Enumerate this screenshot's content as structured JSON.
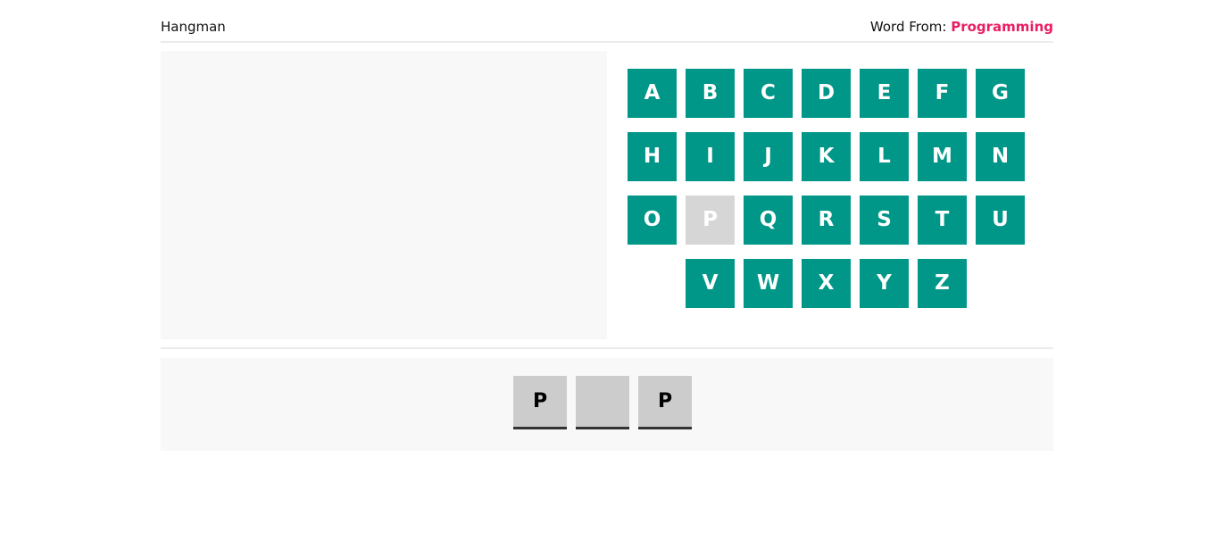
{
  "header": {
    "title": "Hangman",
    "category_label": "Word From: ",
    "category_value": "Programming"
  },
  "colors": {
    "key_active": "#009688",
    "key_used": "#d6d6d6",
    "accent": "#e91e63",
    "slot_bg": "#cccccc"
  },
  "keyboard": {
    "rows": [
      [
        {
          "letter": "A",
          "used": false
        },
        {
          "letter": "B",
          "used": false
        },
        {
          "letter": "C",
          "used": false
        },
        {
          "letter": "D",
          "used": false
        },
        {
          "letter": "E",
          "used": false
        },
        {
          "letter": "F",
          "used": false
        },
        {
          "letter": "G",
          "used": false
        }
      ],
      [
        {
          "letter": "H",
          "used": false
        },
        {
          "letter": "I",
          "used": false
        },
        {
          "letter": "J",
          "used": false
        },
        {
          "letter": "K",
          "used": false
        },
        {
          "letter": "L",
          "used": false
        },
        {
          "letter": "M",
          "used": false
        },
        {
          "letter": "N",
          "used": false
        }
      ],
      [
        {
          "letter": "O",
          "used": false
        },
        {
          "letter": "P",
          "used": true
        },
        {
          "letter": "Q",
          "used": false
        },
        {
          "letter": "R",
          "used": false
        },
        {
          "letter": "S",
          "used": false
        },
        {
          "letter": "T",
          "used": false
        },
        {
          "letter": "U",
          "used": false
        }
      ],
      [
        {
          "letter": "V",
          "used": false
        },
        {
          "letter": "W",
          "used": false
        },
        {
          "letter": "X",
          "used": false
        },
        {
          "letter": "Y",
          "used": false
        },
        {
          "letter": "Z",
          "used": false
        }
      ]
    ]
  },
  "word": {
    "slots": [
      "P",
      "",
      "P"
    ]
  }
}
